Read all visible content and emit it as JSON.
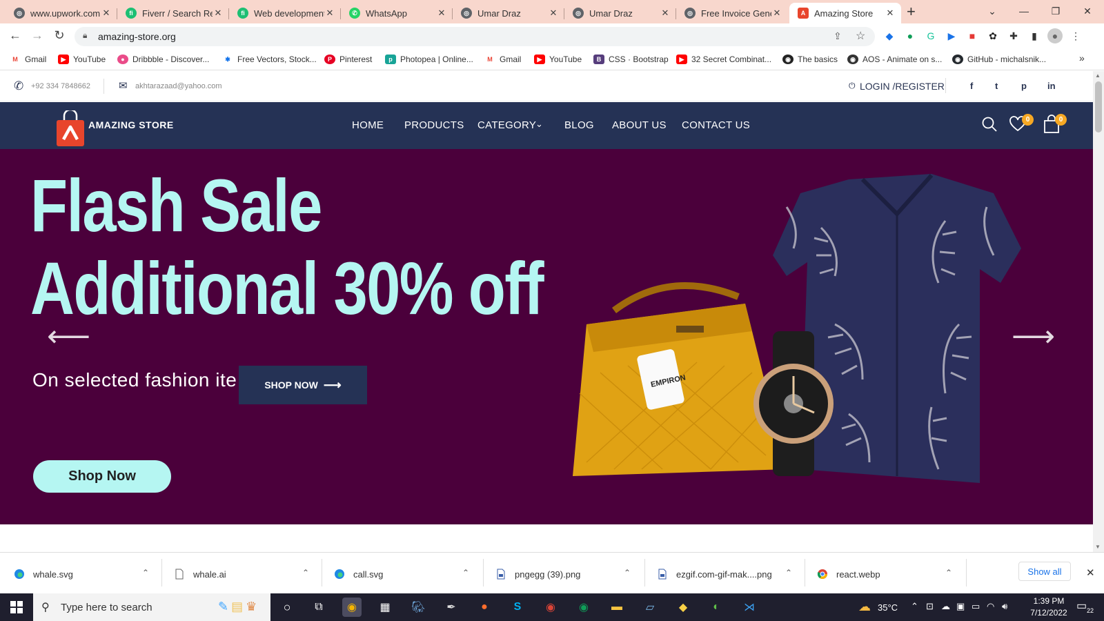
{
  "browser": {
    "tabs": [
      {
        "title": "www.upwork.com",
        "fav_color": "#5f6368",
        "fav_glyph": "◎"
      },
      {
        "title": "Fiverr / Search Resu",
        "fav_color": "#1dbf73",
        "fav_glyph": "fi"
      },
      {
        "title": "Web development",
        "fav_color": "#1dbf73",
        "fav_glyph": "fi"
      },
      {
        "title": "WhatsApp",
        "fav_color": "#25d366",
        "fav_glyph": "✆"
      },
      {
        "title": "Umar Draz",
        "fav_color": "#5f6368",
        "fav_glyph": "◎"
      },
      {
        "title": "Umar Draz",
        "fav_color": "#5f6368",
        "fav_glyph": "◎"
      },
      {
        "title": "Free Invoice Gener",
        "fav_color": "#5f6368",
        "fav_glyph": "◎"
      },
      {
        "title": "Amazing Store",
        "fav_color": "#e8452c",
        "fav_glyph": "A"
      }
    ],
    "new_tab": "+",
    "url": "amazing-store.org",
    "bookmarks": [
      {
        "label": "Gmail",
        "color": "#ea4335",
        "glyph": "M"
      },
      {
        "label": "YouTube",
        "color": "#ff0000",
        "glyph": "▶"
      },
      {
        "label": "Dribbble - Discover...",
        "color": "#ea4c89",
        "glyph": "●"
      },
      {
        "label": "Free Vectors, Stock...",
        "color": "#1273eb",
        "glyph": "✱"
      },
      {
        "label": "Pinterest",
        "color": "#e60023",
        "glyph": "P"
      },
      {
        "label": "Photopea | Online...",
        "color": "#18a497",
        "glyph": "p"
      },
      {
        "label": "Gmail",
        "color": "#ea4335",
        "glyph": "M"
      },
      {
        "label": "YouTube",
        "color": "#ff0000",
        "glyph": "▶"
      },
      {
        "label": "CSS · Bootstrap",
        "color": "#563d7c",
        "glyph": "B"
      },
      {
        "label": "32 Secret Combinat...",
        "color": "#ff0000",
        "glyph": "▶"
      },
      {
        "label": "The basics",
        "color": "#222222",
        "glyph": "◉"
      },
      {
        "label": "AOS - Animate on s...",
        "color": "#333333",
        "glyph": "◉"
      },
      {
        "label": "GitHub - michalsnik...",
        "color": "#24292e",
        "glyph": "◉"
      }
    ]
  },
  "site": {
    "phone": "+92 334 7848662",
    "email": "akhtarazaad@yahoo.com",
    "login": "LOGIN /REGISTER",
    "social": [
      "f",
      "t",
      "p",
      "in"
    ],
    "brand": "AMAZING STORE",
    "nav": [
      "HOME",
      "PRODUCTS",
      "CATEGORY",
      "BLOG",
      "ABOUT US",
      "CONTACT US"
    ],
    "wishlist_count": "0",
    "cart_count": "0",
    "colors": {
      "nav_bg": "#253255",
      "hero_bg": "#4b003b",
      "hero_text": "#b5f6f2",
      "badge": "#f6a824",
      "logo": "#e8452c"
    }
  },
  "hero": {
    "line1": "Flash Sale",
    "line2": "Additional 30% off",
    "subtitle": "On selected fashion ite",
    "cta_dark": "SHOP NOW",
    "cta_light": "Shop Now",
    "tag_brand": "EMPIRON"
  },
  "downloads": {
    "items": [
      {
        "name": "whale.svg",
        "icon": "edge-icon"
      },
      {
        "name": "whale.ai",
        "icon": "file-icon"
      },
      {
        "name": "call.svg",
        "icon": "edge-icon"
      },
      {
        "name": "pngegg (39).png",
        "icon": "image-file-icon"
      },
      {
        "name": "ezgif.com-gif-mak....png",
        "icon": "image-file-icon"
      },
      {
        "name": "react.webp",
        "icon": "chrome-icon"
      }
    ],
    "show_all": "Show all"
  },
  "taskbar": {
    "search_placeholder": "Type here to search",
    "temperature": "35°C",
    "time": "1:39 PM",
    "date": "7/12/2022",
    "notifications": "22"
  }
}
